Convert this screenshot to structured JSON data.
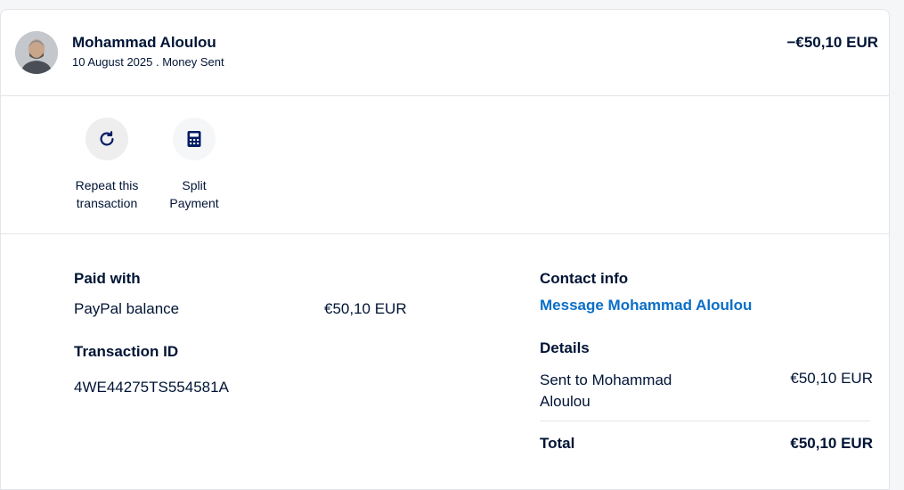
{
  "header": {
    "name": "Mohammad Aloulou",
    "date": "10 August 2025",
    "type": "Money Sent",
    "subline": "10 August 2025 . Money Sent",
    "amount": "−€50,10 EUR"
  },
  "actions": [
    {
      "label": "Repeat this\ntransaction",
      "icon": "repeat-icon"
    },
    {
      "label": "Split\nPayment",
      "icon": "calculator-icon"
    }
  ],
  "paid_with": {
    "title": "Paid with",
    "method": "PayPal balance",
    "amount": "€50,10 EUR"
  },
  "transaction": {
    "title": "Transaction ID",
    "id": "4WE44275TS554581A"
  },
  "contact": {
    "title": "Contact info",
    "link": "Message Mohammad Aloulou"
  },
  "details": {
    "title": "Details",
    "sent_to": "Sent to Mohammad\nAloulou",
    "sent_amount": "€50,10 EUR",
    "total_label": "Total",
    "total_amount": "€50,10 EUR"
  },
  "colors": {
    "text": "#001435",
    "link": "#0a6ec8",
    "divider": "#e3e5e8",
    "icon_bg_repeat": "#eeeeee",
    "icon_bg_split": "#f5f6f7"
  }
}
